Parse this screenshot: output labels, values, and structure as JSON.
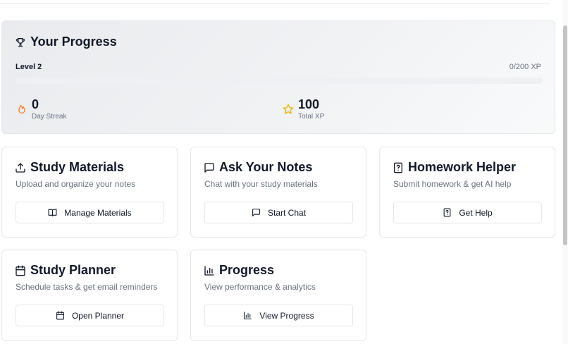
{
  "progress": {
    "title": "Your Progress",
    "level_label": "Level 2",
    "xp_text": "0/200 XP",
    "xp_fraction": 0,
    "streak": {
      "value": "0",
      "label": "Day Streak",
      "icon": "flame-icon"
    },
    "total_xp": {
      "value": "100",
      "label": "Total XP",
      "icon": "star-icon"
    }
  },
  "cards": [
    {
      "title": "Study Materials",
      "description": "Upload and organize your notes",
      "button": "Manage Materials",
      "icon": "upload-icon",
      "button_icon": "book-icon"
    },
    {
      "title": "Ask Your Notes",
      "description": "Chat with your study materials",
      "button": "Start Chat",
      "icon": "chat-icon",
      "button_icon": "chat-icon"
    },
    {
      "title": "Homework Helper",
      "description": "Submit homework & get AI help",
      "button": "Get Help",
      "icon": "help-file-icon",
      "button_icon": "help-file-icon"
    },
    {
      "title": "Study Planner",
      "description": "Schedule tasks & get email reminders",
      "button": "Open Planner",
      "icon": "calendar-icon",
      "button_icon": "calendar-icon"
    },
    {
      "title": "Progress",
      "description": "View performance & analytics",
      "button": "View Progress",
      "icon": "bar-chart-icon",
      "button_icon": "bar-chart-icon"
    }
  ],
  "colors": {
    "flame": "#f97316",
    "star": "#eab308",
    "text": "#111827",
    "muted": "#6b7280",
    "border": "#e5e7eb"
  }
}
